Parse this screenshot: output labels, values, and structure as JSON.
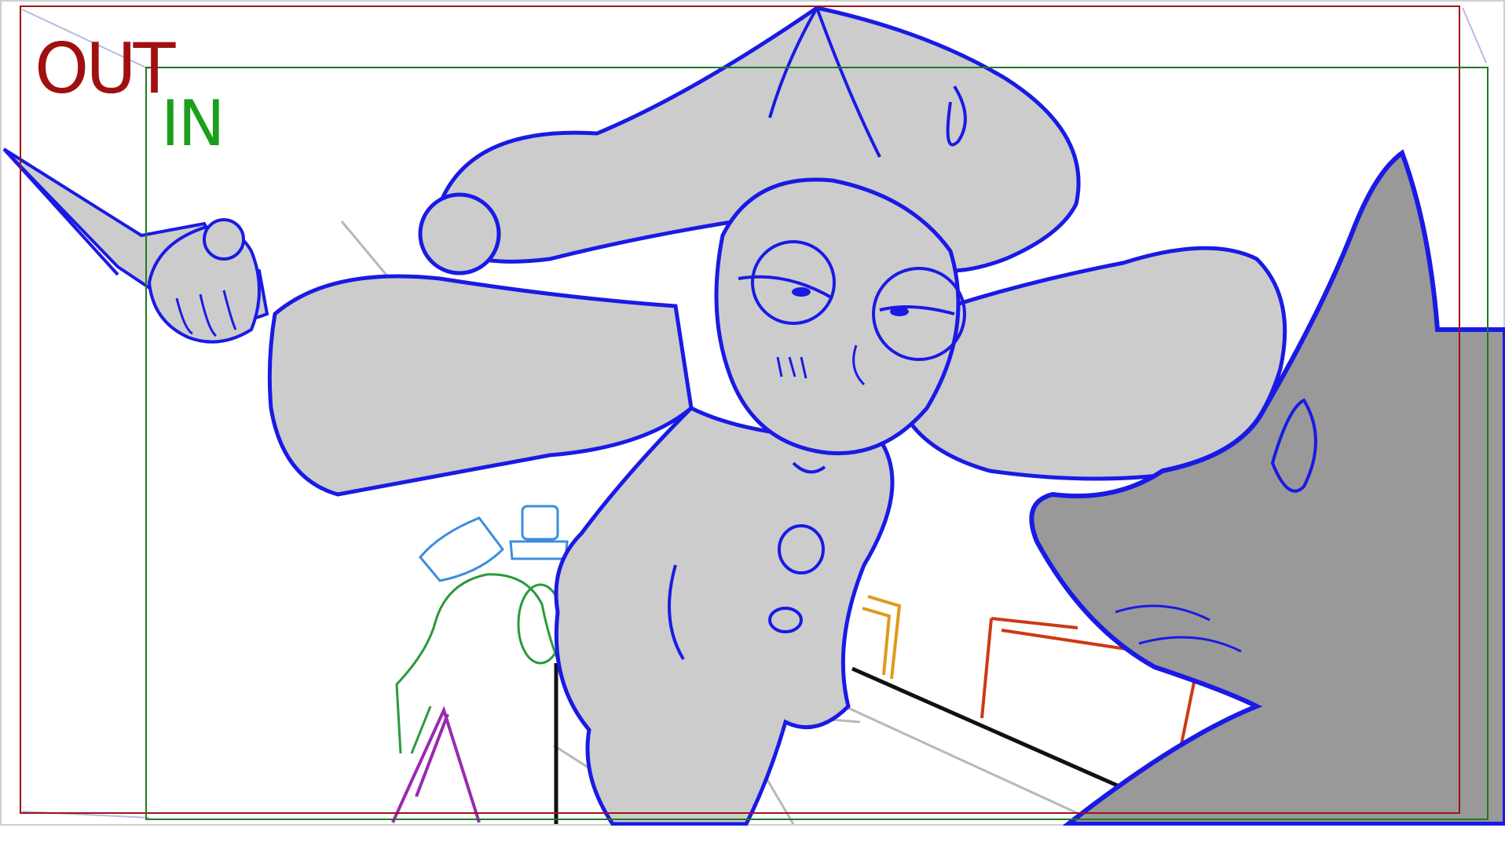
{
  "frame_labels": {
    "out": "OUT",
    "in": "IN"
  },
  "colors": {
    "out_frame": "#a01414",
    "in_frame": "#1f7a1f",
    "out_label": "#a01010",
    "in_label": "#1aa01a",
    "character_stroke": "#1a1ae6",
    "character_fill": "#cccccc",
    "dog_fill": "#999999",
    "set_lines": "#b4b4b4",
    "pillar": "#111111",
    "background_figure": "#2a9a3a",
    "background_hat": "#3a8ee0",
    "background_cone": "#9a2ab0",
    "crate_orange": "#e09a1a",
    "crate_red": "#cc3a14"
  }
}
